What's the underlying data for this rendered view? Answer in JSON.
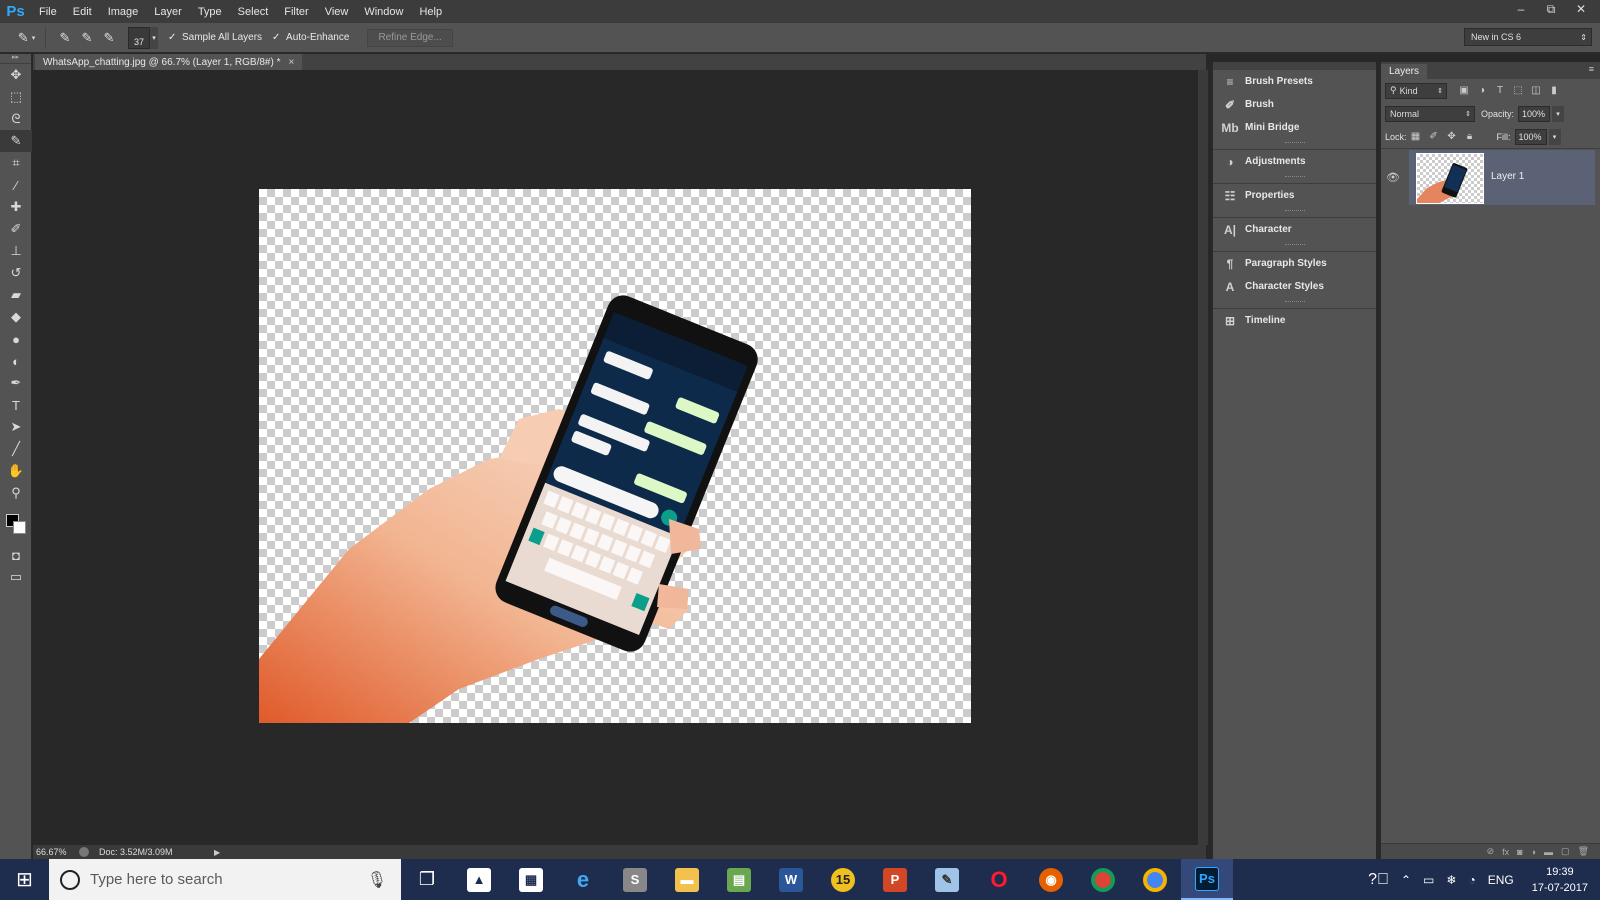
{
  "menubar": {
    "logo": "Ps",
    "items": [
      "File",
      "Edit",
      "Image",
      "Layer",
      "Type",
      "Select",
      "Filter",
      "View",
      "Window",
      "Help"
    ],
    "window_controls": [
      "–",
      "⧉",
      "✕"
    ]
  },
  "options": {
    "brush_size": "37",
    "sample_all_layers": "Sample All Layers",
    "auto_enhance": "Auto-Enhance",
    "refine_edge": "Refine Edge...",
    "workspace": "New in CS 6"
  },
  "document": {
    "tab_title": "WhatsApp_chatting.jpg @ 66.7% (Layer 1, RGB/8#) *",
    "close": "×"
  },
  "status": {
    "zoom": "66.67%",
    "doc": "Doc: 3.52M/3.09M"
  },
  "dock_panels": [
    {
      "icon": "brush-presets-icon",
      "label": "Brush Presets"
    },
    {
      "icon": "brush-icon",
      "label": "Brush"
    },
    {
      "icon": "mini-bridge-icon",
      "label": "Mini Bridge"
    },
    {
      "icon": "adjustments-icon",
      "label": "Adjustments"
    },
    {
      "icon": "properties-icon",
      "label": "Properties"
    },
    {
      "icon": "character-icon",
      "label": "Character"
    },
    {
      "icon": "paragraph-styles-icon",
      "label": "Paragraph Styles"
    },
    {
      "icon": "character-styles-icon",
      "label": "Character Styles"
    },
    {
      "icon": "timeline-icon",
      "label": "Timeline"
    }
  ],
  "layers": {
    "tab": "Layers",
    "filter_kind": "Kind",
    "blend_mode": "Normal",
    "opacity_label": "Opacity:",
    "opacity": "100%",
    "lock_label": "Lock:",
    "fill_label": "Fill:",
    "fill": "100%",
    "items": [
      {
        "name": "Layer 1",
        "visible": true,
        "selected": true
      }
    ]
  },
  "taskbar": {
    "search_placeholder": "Type here to search",
    "language": "ENG",
    "time": "19:39",
    "date": "17-07-2017"
  },
  "colors": {
    "accent_ps": "#31a8ff",
    "taskbar": "#1e2c4e",
    "layer_selected": "#5b6276"
  }
}
